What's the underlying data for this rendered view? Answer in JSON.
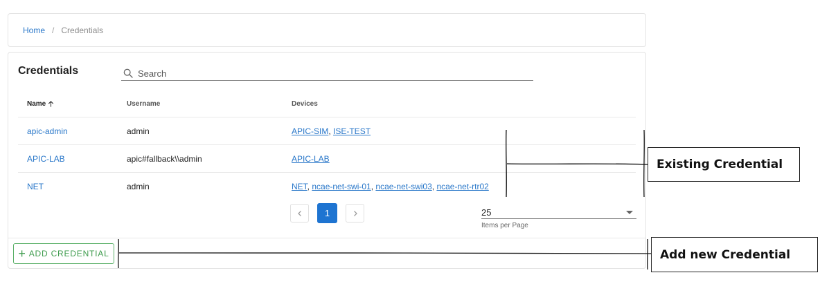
{
  "breadcrumb": {
    "home": "Home",
    "separator": "/",
    "current": "Credentials"
  },
  "page": {
    "title": "Credentials"
  },
  "search": {
    "placeholder": "Search"
  },
  "table": {
    "headers": {
      "name": "Name",
      "username": "Username",
      "devices": "Devices"
    },
    "rows": [
      {
        "name": "apic-admin",
        "username": "admin",
        "devices": [
          "APIC-SIM",
          "ISE-TEST"
        ]
      },
      {
        "name": "APIC-LAB",
        "username": "apic#fallback\\\\admin",
        "devices": [
          "APIC-LAB"
        ]
      },
      {
        "name": "NET",
        "username": "admin",
        "devices": [
          "NET",
          "ncae-net-swi-01",
          "ncae-net-swi03",
          "ncae-net-rtr02"
        ]
      }
    ]
  },
  "pagination": {
    "current_page": "1",
    "items_per_page": "25",
    "items_per_page_label": "Items per Page"
  },
  "actions": {
    "add_label": "ADD CREDENTIAL"
  },
  "annotations": {
    "existing": "Existing Credential",
    "add_new": "Add new Credential"
  },
  "colors": {
    "link": "#2977c9",
    "primary": "#1e74d1",
    "success": "#3d9b4c"
  }
}
